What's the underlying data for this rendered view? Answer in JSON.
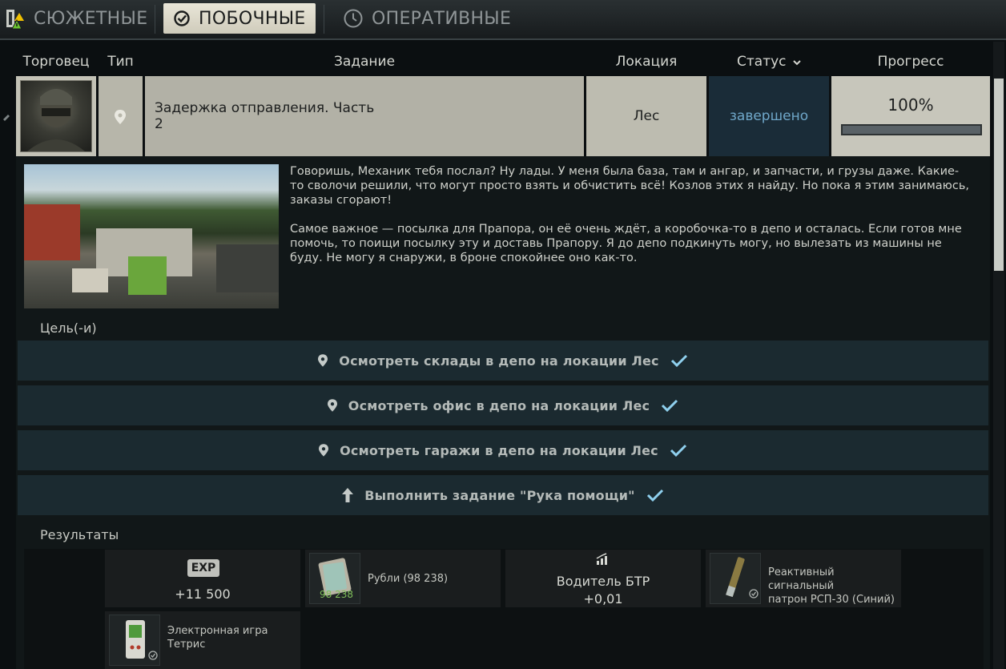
{
  "tabs": [
    {
      "label": "СЮЖЕТНЫЕ",
      "active": false,
      "icon": "story-icon"
    },
    {
      "label": "ПОБОЧНЫЕ",
      "active": true,
      "icon": "check-circle-icon"
    },
    {
      "label": "ОПЕРАТИВНЫЕ",
      "active": false,
      "icon": "clock-icon"
    }
  ],
  "columns": {
    "trader": "Торговец",
    "type": "Тип",
    "task": "Задание",
    "location": "Локация",
    "status": "Статус",
    "progress": "Прогресс"
  },
  "quest": {
    "name_line1": "Задержка отправления. Часть",
    "name_line2": "2",
    "location": "Лес",
    "status": "завершено",
    "progress_text": "100%",
    "progress_value": 1.0
  },
  "description": {
    "p1": "Говоришь, Механик тебя послал? Ну лады. У меня была база, там и ангар, и запчасти, и грузы даже. Какие-то сволочи решили, что могут просто взять и обчистить всё! Козлов этих я найду. Но пока я этим занимаюсь, заказы сгорают!",
    "p2": "Самое важное — посылка для Прапора, он её очень ждёт, а коробочка-то в депо и осталась. Если готов мне помочь, то поищи посылку эту и доставь Прапору. Я до депо подкинуть могу, но вылезать из машины не буду. Не могу я снаружи, в броне спокойнее оно как-то."
  },
  "objectives_label": "Цель(-и)",
  "objectives": [
    {
      "text": "Осмотреть склады в депо на локации Лес",
      "icon": "location-pin-icon",
      "done": true
    },
    {
      "text": "Осмотреть офис в депо на локации Лес",
      "icon": "location-pin-icon",
      "done": true
    },
    {
      "text": "Осмотреть гаражи в депо на локации Лес",
      "icon": "location-pin-icon",
      "done": true
    },
    {
      "text": "Выполнить задание \"Рука помощи\"",
      "icon": "arrow-up-icon",
      "done": true
    }
  ],
  "results_label": "Результаты",
  "rewards": {
    "exp_badge": "EXP",
    "exp_value": "+11 500",
    "rubles_label": "Рубли (98 238)",
    "rubles_count": "98 238",
    "skill_name": "Водитель БТР",
    "skill_value": "+0,01",
    "flare_line1": "Реактивный сигнальный",
    "flare_line2": "патрон РСП-30 (Синий)",
    "tetris_line1": "Электронная игра",
    "tetris_line2": "Тетрис"
  },
  "colors": {
    "status_done": "#6fa7c9",
    "check": "#8fd0ee"
  }
}
